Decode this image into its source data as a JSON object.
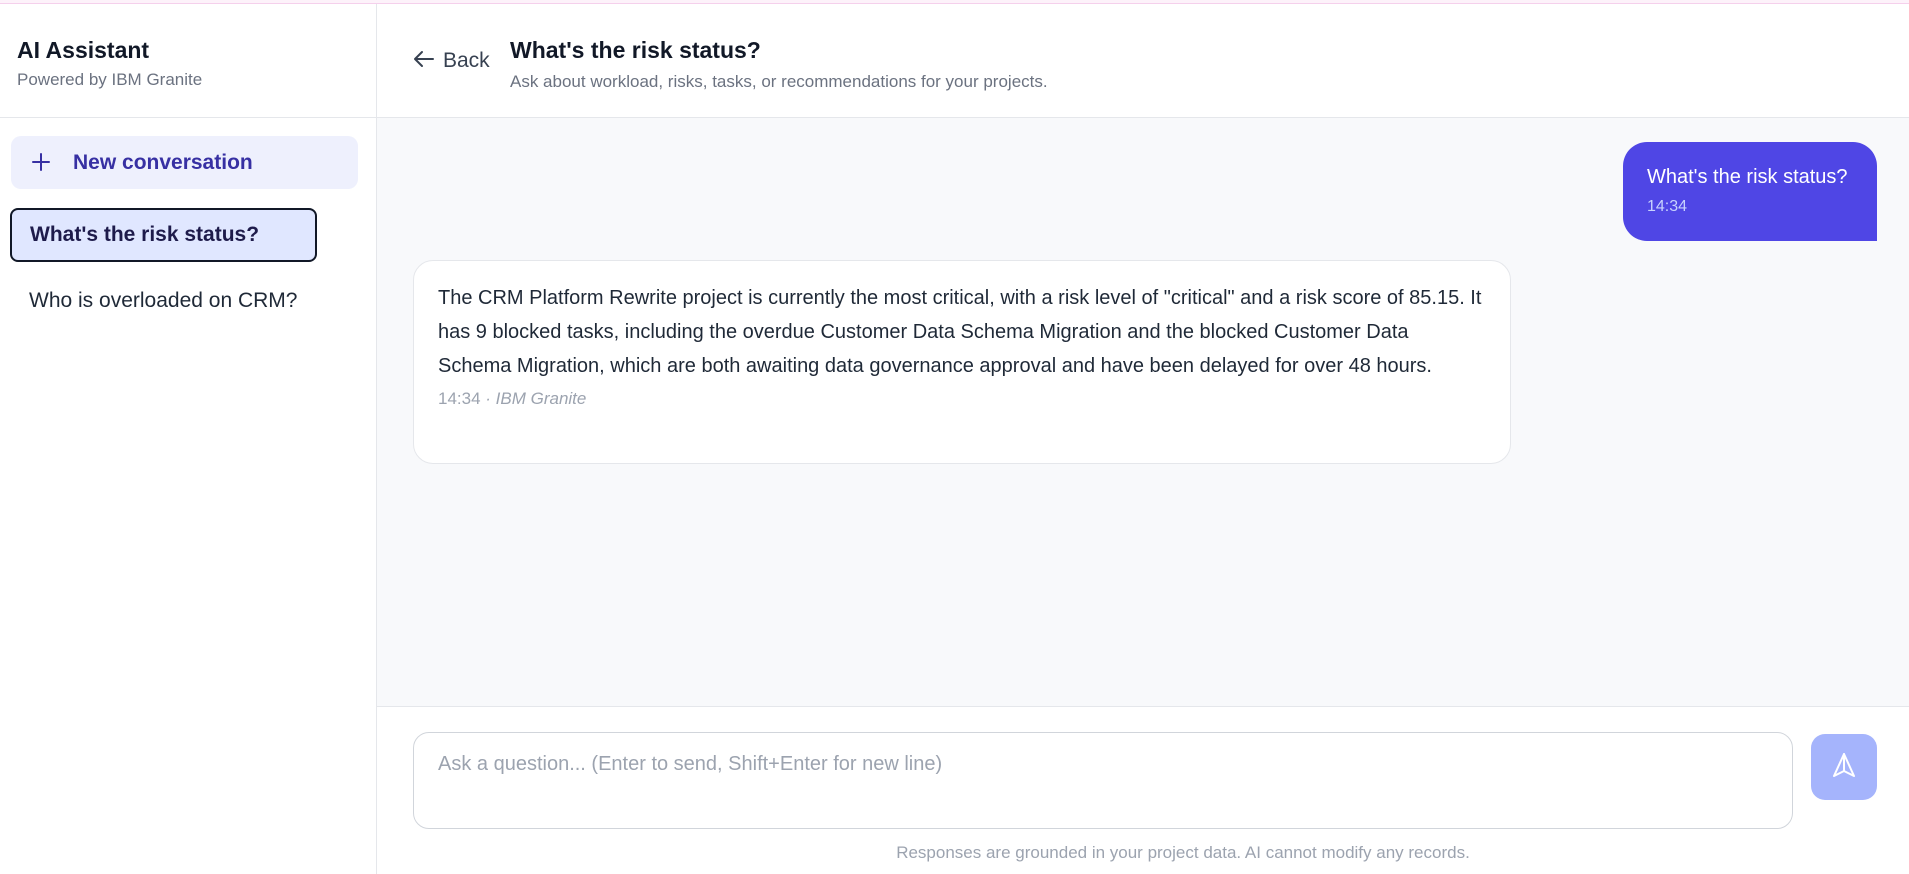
{
  "sidebar": {
    "title": "AI Assistant",
    "subtitle": "Powered by IBM Granite",
    "new_conversation_label": "New conversation",
    "conversations": [
      {
        "label": "What's the risk status?",
        "active": true
      },
      {
        "label": "Who is overloaded on CRM?",
        "active": false
      }
    ]
  },
  "header": {
    "back_label": "Back",
    "title": "What's the risk status?",
    "subtitle": "Ask about workload, risks, tasks, or recommendations for your projects."
  },
  "messages": [
    {
      "role": "user",
      "text": "What's the risk status?",
      "time": "14:34"
    },
    {
      "role": "assistant",
      "text": "The CRM Platform Rewrite project is currently the most critical, with a risk level of \"critical\" and a risk score of 85.15. It has 9 blocked tasks, including the overdue Customer Data Schema Migration and the blocked Customer Data Schema Migration, which are both awaiting data governance approval and have been delayed for over 48 hours.",
      "time": "14:34",
      "model": "· IBM Granite"
    }
  ],
  "composer": {
    "placeholder": "Ask a question... (Enter to send, Shift+Enter for new line)",
    "value": "",
    "send_icon": "send-icon",
    "disclaimer": "Responses are grounded in your project data. AI cannot modify any records."
  },
  "colors": {
    "accent": "#4f46e5",
    "accent_light": "#eef0fd",
    "send_disabled": "#a5b4fc"
  }
}
